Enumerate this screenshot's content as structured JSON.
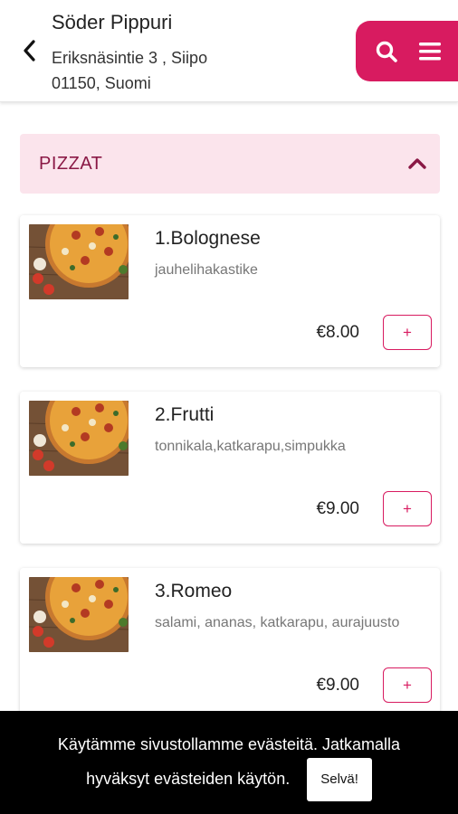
{
  "header": {
    "shop_name": "Söder Pippuri",
    "address_line1": "Eriksnäsintie 3 , Siipo",
    "address_line2": "01150, Suomi",
    "back_icon": "chevron-left-icon",
    "search_icon": "search-icon",
    "menu_icon": "hamburger-menu-icon"
  },
  "category": {
    "title": "PIZZAT",
    "toggle_icon": "chevron-up-icon"
  },
  "products": [
    {
      "name": "1.Bolognese",
      "description": "jauhelihakastike",
      "price": "€8.00",
      "add_label": "+"
    },
    {
      "name": "2.Frutti",
      "description": "tonnikala,katkarapu,simpukka",
      "price": "€9.00",
      "add_label": "+"
    },
    {
      "name": "3.Romeo",
      "description": "salami, ananas, katkarapu, aurajuusto",
      "price": "€9.00",
      "add_label": "+"
    }
  ],
  "cookie": {
    "text_line1": "Käytämme sivustollamme evästeitä. Jatkamalla",
    "text_line2": "hyväksyt evästeiden käytön.",
    "accept_label": "Selvä!"
  },
  "colors": {
    "accent": "#d81b60",
    "category_bg": "#fbe4ec",
    "category_text": "#8a1845",
    "banner_bg": "#000000"
  }
}
